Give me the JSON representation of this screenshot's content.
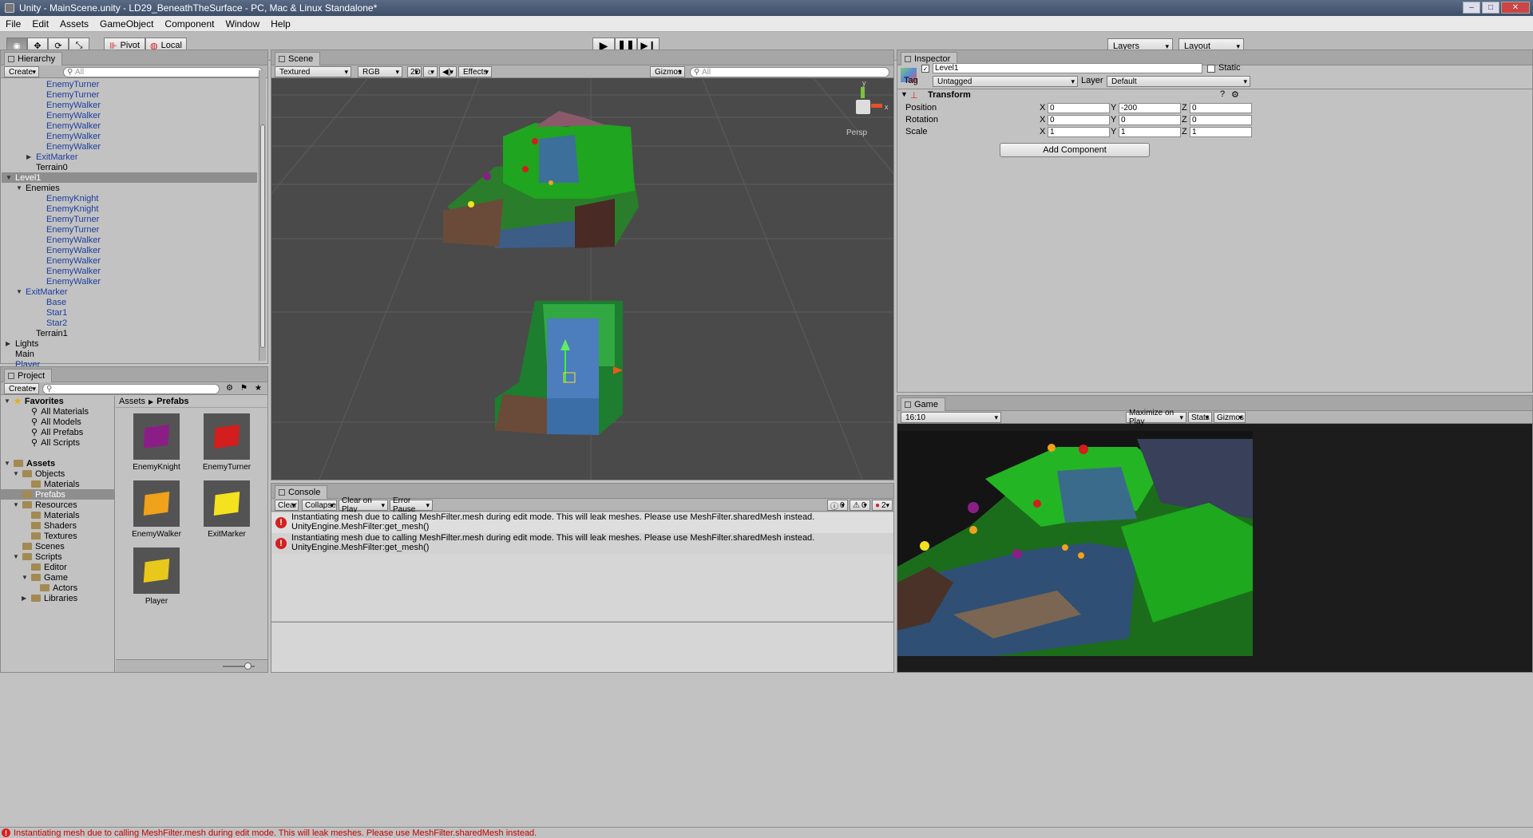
{
  "window": {
    "title": "Unity - MainScene.unity - LD29_BeneathTheSurface - PC, Mac & Linux Standalone*"
  },
  "menu": [
    "File",
    "Edit",
    "Assets",
    "GameObject",
    "Component",
    "Window",
    "Help"
  ],
  "toolbar": {
    "pivot": "Pivot",
    "local": "Local",
    "layers": "Layers",
    "layout": "Layout"
  },
  "hierarchy": {
    "tab": "Hierarchy",
    "create": "Create",
    "search": "All",
    "items": [
      {
        "label": "EnemyTurner",
        "indent": 3,
        "blue": true,
        "arrow": ""
      },
      {
        "label": "EnemyTurner",
        "indent": 3,
        "blue": true,
        "arrow": ""
      },
      {
        "label": "EnemyWalker",
        "indent": 3,
        "blue": true,
        "arrow": ""
      },
      {
        "label": "EnemyWalker",
        "indent": 3,
        "blue": true,
        "arrow": ""
      },
      {
        "label": "EnemyWalker",
        "indent": 3,
        "blue": true,
        "arrow": ""
      },
      {
        "label": "EnemyWalker",
        "indent": 3,
        "blue": true,
        "arrow": ""
      },
      {
        "label": "EnemyWalker",
        "indent": 3,
        "blue": true,
        "arrow": ""
      },
      {
        "label": "ExitMarker",
        "indent": 2,
        "blue": true,
        "arrow": "right"
      },
      {
        "label": "Terrain0",
        "indent": 2,
        "blue": false,
        "arrow": ""
      },
      {
        "label": "Level1",
        "indent": 0,
        "blue": false,
        "arrow": "down",
        "selected": true
      },
      {
        "label": "Enemies",
        "indent": 1,
        "blue": false,
        "arrow": "down"
      },
      {
        "label": "EnemyKnight",
        "indent": 3,
        "blue": true,
        "arrow": ""
      },
      {
        "label": "EnemyKnight",
        "indent": 3,
        "blue": true,
        "arrow": ""
      },
      {
        "label": "EnemyTurner",
        "indent": 3,
        "blue": true,
        "arrow": ""
      },
      {
        "label": "EnemyTurner",
        "indent": 3,
        "blue": true,
        "arrow": ""
      },
      {
        "label": "EnemyWalker",
        "indent": 3,
        "blue": true,
        "arrow": ""
      },
      {
        "label": "EnemyWalker",
        "indent": 3,
        "blue": true,
        "arrow": ""
      },
      {
        "label": "EnemyWalker",
        "indent": 3,
        "blue": true,
        "arrow": ""
      },
      {
        "label": "EnemyWalker",
        "indent": 3,
        "blue": true,
        "arrow": ""
      },
      {
        "label": "EnemyWalker",
        "indent": 3,
        "blue": true,
        "arrow": ""
      },
      {
        "label": "ExitMarker",
        "indent": 1,
        "blue": true,
        "arrow": "down"
      },
      {
        "label": "Base",
        "indent": 3,
        "blue": true,
        "arrow": ""
      },
      {
        "label": "Star1",
        "indent": 3,
        "blue": true,
        "arrow": ""
      },
      {
        "label": "Star2",
        "indent": 3,
        "blue": true,
        "arrow": ""
      },
      {
        "label": "Terrain1",
        "indent": 2,
        "blue": false,
        "arrow": ""
      },
      {
        "label": "Lights",
        "indent": 0,
        "blue": false,
        "arrow": "right"
      },
      {
        "label": "Main",
        "indent": 0,
        "blue": false,
        "arrow": ""
      },
      {
        "label": "Player",
        "indent": 0,
        "blue": true,
        "arrow": ""
      }
    ]
  },
  "project": {
    "tab": "Project",
    "create": "Create",
    "breadcrumb": [
      "Assets",
      "Prefabs"
    ],
    "tree": [
      {
        "label": "Favorites",
        "indent": 0,
        "type": "star",
        "arrow": "down",
        "bold": true
      },
      {
        "label": "All Materials",
        "indent": 2,
        "type": "search"
      },
      {
        "label": "All Models",
        "indent": 2,
        "type": "search"
      },
      {
        "label": "All Prefabs",
        "indent": 2,
        "type": "search"
      },
      {
        "label": "All Scripts",
        "indent": 2,
        "type": "search"
      },
      {
        "label": "",
        "indent": 0,
        "type": "blank"
      },
      {
        "label": "Assets",
        "indent": 0,
        "type": "folder",
        "arrow": "down",
        "bold": true
      },
      {
        "label": "Objects",
        "indent": 1,
        "type": "folder",
        "arrow": "down"
      },
      {
        "label": "Materials",
        "indent": 2,
        "type": "folder"
      },
      {
        "label": "Prefabs",
        "indent": 1,
        "type": "folder",
        "selected": true
      },
      {
        "label": "Resources",
        "indent": 1,
        "type": "folder",
        "arrow": "down"
      },
      {
        "label": "Materials",
        "indent": 2,
        "type": "folder"
      },
      {
        "label": "Shaders",
        "indent": 2,
        "type": "folder"
      },
      {
        "label": "Textures",
        "indent": 2,
        "type": "folder"
      },
      {
        "label": "Scenes",
        "indent": 1,
        "type": "folder"
      },
      {
        "label": "Scripts",
        "indent": 1,
        "type": "folder",
        "arrow": "down"
      },
      {
        "label": "Editor",
        "indent": 2,
        "type": "folder"
      },
      {
        "label": "Game",
        "indent": 2,
        "type": "folder",
        "arrow": "down"
      },
      {
        "label": "Actors",
        "indent": 3,
        "type": "folder"
      },
      {
        "label": "Libraries",
        "indent": 2,
        "type": "folder",
        "arrow": "right"
      }
    ],
    "assets": [
      {
        "label": "EnemyKnight",
        "color": "#8b1e86"
      },
      {
        "label": "EnemyTurner",
        "color": "#d41d1d"
      },
      {
        "label": "EnemyWalker",
        "color": "#f0a21a"
      },
      {
        "label": "ExitMarker",
        "color": "#f4e21e"
      },
      {
        "label": "Player",
        "color": "#e8c81a"
      }
    ]
  },
  "scene": {
    "tab": "Scene",
    "shading": "Textured",
    "rgb": "RGB",
    "mode2d": "2D",
    "effects": "Effects",
    "gizmos": "Gizmos",
    "search": "All",
    "persp": "Persp",
    "axis_y": "y",
    "axis_x": "x"
  },
  "console": {
    "tab": "Console",
    "buttons": [
      "Clear",
      "Collapse",
      "Clear on Play",
      "Error Pause"
    ],
    "counts": {
      "info": "0",
      "warn": "0",
      "error": "2"
    },
    "entries": [
      {
        "line1": "Instantiating mesh due to calling MeshFilter.mesh during edit mode. This will leak meshes. Please use MeshFilter.sharedMesh instead.",
        "line2": "UnityEngine.MeshFilter:get_mesh()"
      },
      {
        "line1": "Instantiating mesh due to calling MeshFilter.mesh during edit mode. This will leak meshes. Please use MeshFilter.sharedMesh instead.",
        "line2": "UnityEngine.MeshFilter:get_mesh()"
      }
    ]
  },
  "inspector": {
    "tab": "Inspector",
    "object_name": "Level1",
    "static_label": "Static",
    "tag_label": "Tag",
    "tag_value": "Untagged",
    "layer_label": "Layer",
    "layer_value": "Default",
    "component": "Transform",
    "rows": [
      {
        "label": "Position",
        "x": "0",
        "y": "-200",
        "z": "0"
      },
      {
        "label": "Rotation",
        "x": "0",
        "y": "0",
        "z": "0"
      },
      {
        "label": "Scale",
        "x": "1",
        "y": "1",
        "z": "1"
      }
    ],
    "axis": [
      "X",
      "Y",
      "Z"
    ],
    "add_component": "Add Component"
  },
  "game": {
    "tab": "Game",
    "aspect": "16:10",
    "maximize": "Maximize on Play",
    "stats": "Stats",
    "gizmos": "Gizmos"
  },
  "status": {
    "message": "Instantiating mesh due to calling MeshFilter.mesh during edit mode. This will leak meshes. Please use MeshFilter.sharedMesh instead."
  },
  "colors": {
    "selection": "#8e8e8e",
    "prefab_blue": "#1b3d9e",
    "error_red": "#d62020",
    "scene_bg": "#4a4a4a"
  }
}
